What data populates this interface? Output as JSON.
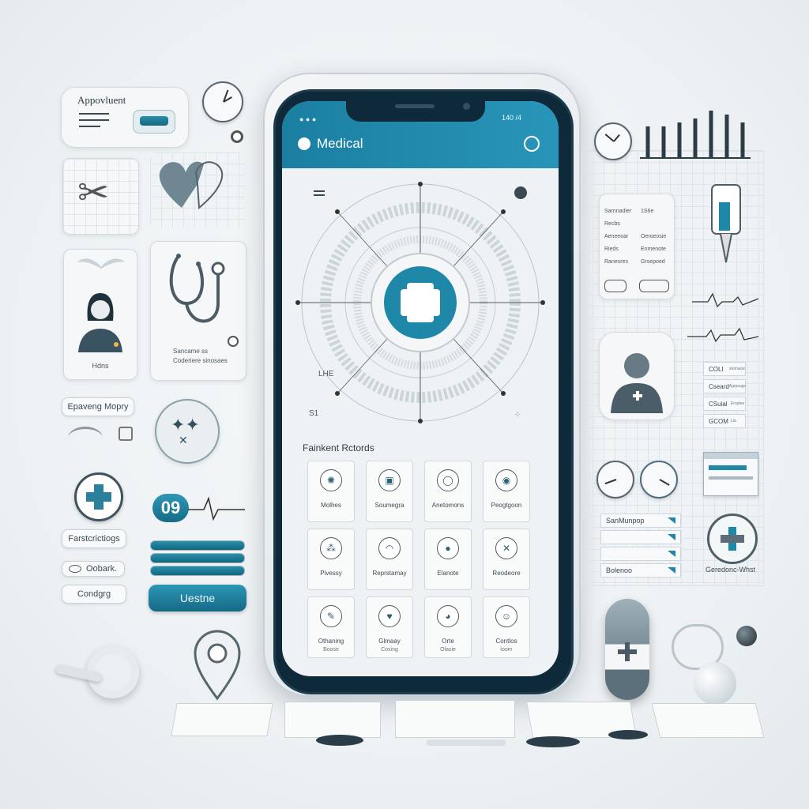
{
  "app": {
    "title": "Medical",
    "status_text": "140 /4"
  },
  "screen": {
    "section_title": "Fainkent Rctords",
    "tiles": [
      {
        "label": "Molhes",
        "sub": "",
        "icon": "virus-icon"
      },
      {
        "label": "Soumegra",
        "sub": "",
        "icon": "screen-icon"
      },
      {
        "label": "Anetomons",
        "sub": "",
        "icon": "drop-icon"
      },
      {
        "label": "Peogtgoon",
        "sub": "",
        "icon": "pin-icon"
      },
      {
        "label": "Pivessy",
        "sub": "",
        "icon": "molecule-icon"
      },
      {
        "label": "Reprstamay",
        "sub": "",
        "icon": "balloon-icon"
      },
      {
        "label": "Elanote",
        "sub": "",
        "icon": "person-icon"
      },
      {
        "label": "Reodeore",
        "sub": "",
        "icon": "cross-lines-icon"
      },
      {
        "label": "Othaning",
        "sub": "Boose",
        "icon": "syringe-icon"
      },
      {
        "label": "Glmaay",
        "sub": "Cosing",
        "icon": "heart-icon"
      },
      {
        "label": "Orte",
        "sub": "Olasie",
        "icon": "face-icon"
      },
      {
        "label": "Contlos",
        "sub": "loom",
        "icon": "nurse-icon"
      }
    ],
    "hub_labels": {
      "left": "LHE",
      "bottom_left": "S1"
    }
  },
  "left_panel": {
    "appointment_title": "Appovluent",
    "profile_caption": "Hdns",
    "stetho_caption_1": "Sancame ss",
    "stetho_caption_2": "Coderiere sinosaes",
    "tag_1": "Epaveng Mopry",
    "badge_number": "09",
    "tag_2": "Farstcrictiogs",
    "field_1": "Oobark.",
    "field_2": "Condgrg",
    "cta": "Uestne"
  },
  "right_panel": {
    "form_rows": [
      {
        "k": "Sarnnadier",
        "v": "1S6e"
      },
      {
        "k": "Recbs",
        "v": ""
      },
      {
        "k": "Aeneeoar",
        "v": "Oeroeosie"
      },
      {
        "k": "Rieds",
        "v": "Enmenote"
      },
      {
        "k": "Ranesres",
        "v": "Grsepoed"
      }
    ],
    "checklist": [
      {
        "k": "COLI",
        "v": "stomacie"
      },
      {
        "k": "Cseard",
        "v": "Agrpsugs"
      },
      {
        "k": "CSuial",
        "v": "Eropiee"
      },
      {
        "k": "GCOM",
        "v": "Lla"
      }
    ],
    "list_rows": [
      "SanMunpop",
      "",
      "",
      "Bolenoo"
    ],
    "footer_label": "Geredonc-Whst"
  },
  "colors": {
    "accent": "#1b7fa2",
    "accent_dark": "#13677f",
    "ink": "#2d3b44"
  }
}
